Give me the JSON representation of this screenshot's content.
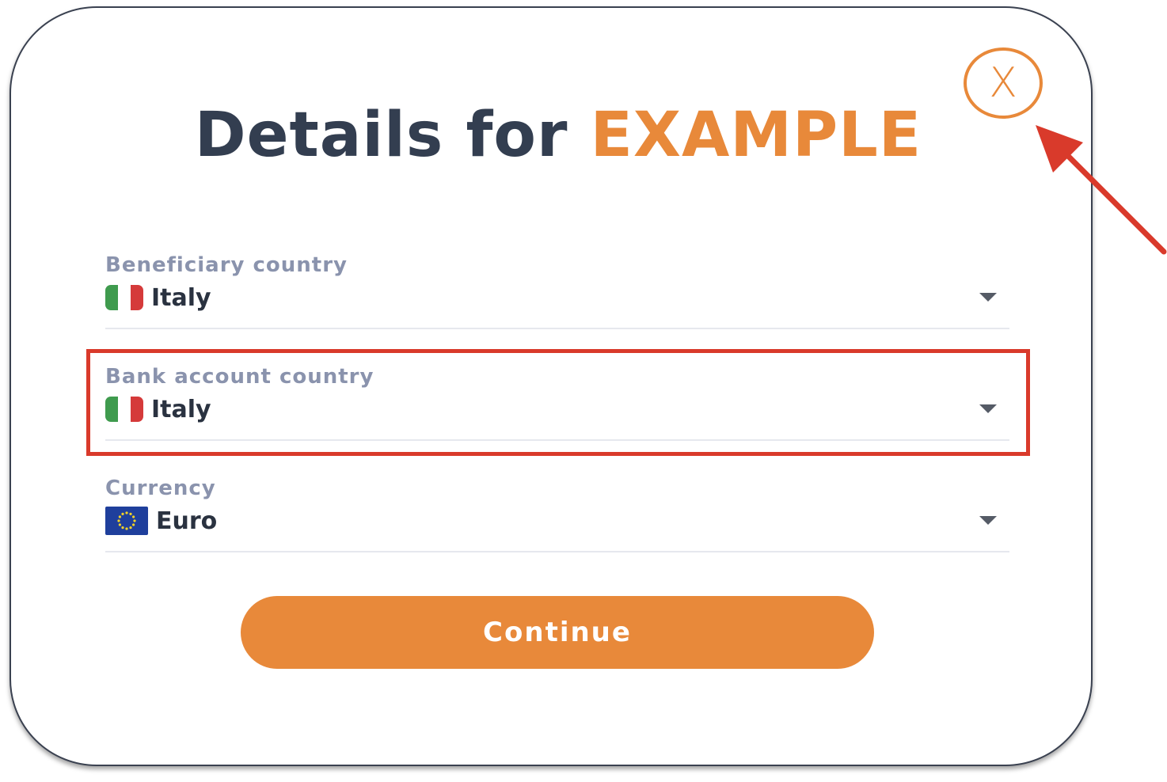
{
  "modal": {
    "title_prefix": "Details for ",
    "title_highlight": "EXAMPLE",
    "close_label": "X"
  },
  "fields": [
    {
      "label": "Beneficiary country",
      "value": "Italy",
      "flag": "italy-flag-icon"
    },
    {
      "label": "Bank account country",
      "value": "Italy",
      "flag": "italy-flag-icon"
    },
    {
      "label": "Currency",
      "value": "Euro",
      "flag": "eu-flag-icon"
    }
  ],
  "actions": {
    "continue_label": "Continue"
  },
  "annotations": {
    "highlight_target": "Bank account country",
    "arrow_target": "close-button"
  },
  "colors": {
    "accent": "#e8893a",
    "title_dark": "#333e50",
    "label": "#8a93ad",
    "annotation_red": "#d93a2b"
  }
}
